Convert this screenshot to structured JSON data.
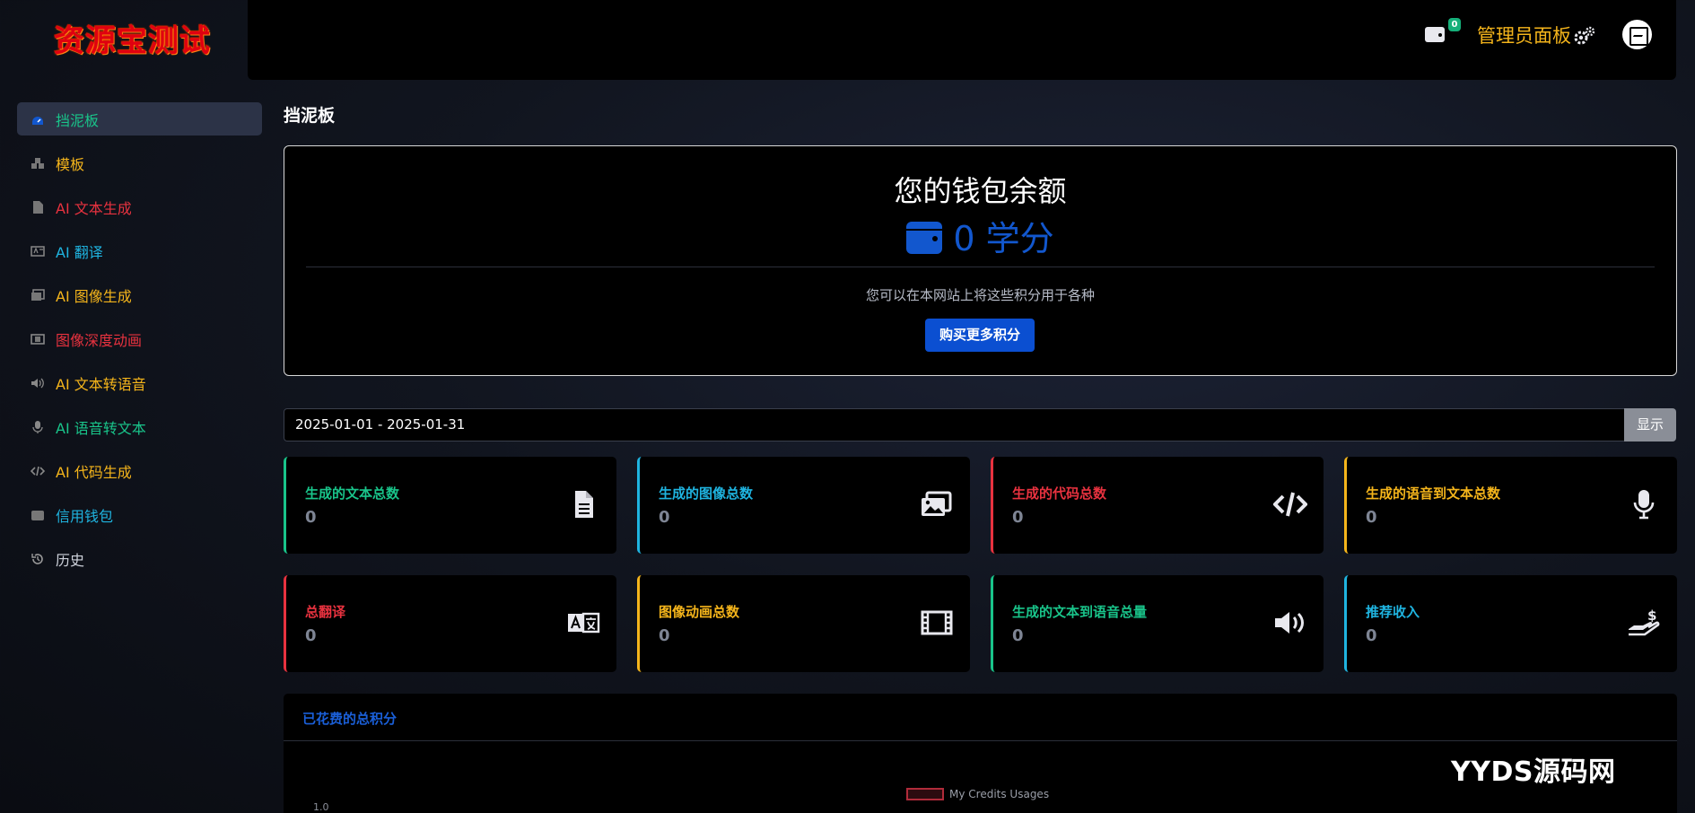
{
  "header": {
    "logo_text": "资源宝测试",
    "wallet_badge": "0",
    "admin_label": "管理员面板"
  },
  "sidebar": {
    "items": [
      {
        "label": "挡泥板",
        "color": "#19c48a",
        "icon": "dashboard-icon",
        "active": true
      },
      {
        "label": "模板",
        "color": "#f5b51b",
        "icon": "boxes-icon"
      },
      {
        "label": "AI 文本生成",
        "color": "#e8323f",
        "icon": "file-icon"
      },
      {
        "label": "AI 翻译",
        "color": "#1fb4e0",
        "icon": "language-icon"
      },
      {
        "label": "AI 图像生成",
        "color": "#f5b51b",
        "icon": "images-icon"
      },
      {
        "label": "图像深度动画",
        "color": "#e8323f",
        "icon": "film-icon"
      },
      {
        "label": "AI 文本转语音",
        "color": "#f5b51b",
        "icon": "volume-icon"
      },
      {
        "label": "AI 语音转文本",
        "color": "#19c48a",
        "icon": "microphone-icon"
      },
      {
        "label": "AI 代码生成",
        "color": "#f5b51b",
        "icon": "code-icon"
      },
      {
        "label": "信用钱包",
        "color": "#1fb4e0",
        "icon": "wallet-icon"
      },
      {
        "label": "历史",
        "color": "#cfd3dc",
        "icon": "history-icon"
      }
    ]
  },
  "page": {
    "title": "挡泥板"
  },
  "wallet": {
    "title": "您的钱包余额",
    "amount": "0 学分",
    "description": "您可以在本网站上将这些积分用于各种",
    "buy_label": "购买更多积分"
  },
  "filter": {
    "date_range": "2025-01-01 - 2025-01-31",
    "show_label": "显示"
  },
  "stats": [
    {
      "label": "生成的文本总数",
      "value": "0",
      "color": "#19c48a",
      "icon": "file-lines-icon"
    },
    {
      "label": "生成的图像总数",
      "value": "0",
      "color": "#1fb4e0",
      "icon": "images-icon"
    },
    {
      "label": "生成的代码总数",
      "value": "0",
      "color": "#e8323f",
      "icon": "code-icon"
    },
    {
      "label": "生成的语音到文本总数",
      "value": "0",
      "color": "#f5b51b",
      "icon": "microphone-icon"
    },
    {
      "label": "总翻译",
      "value": "0",
      "color": "#e8323f",
      "icon": "language-icon"
    },
    {
      "label": "图像动画总数",
      "value": "0",
      "color": "#f5b51b",
      "icon": "film-icon"
    },
    {
      "label": "生成的文本到语音总量",
      "value": "0",
      "color": "#19c48a",
      "icon": "volume-icon"
    },
    {
      "label": "推荐收入",
      "value": "0",
      "color": "#1fb4e0",
      "icon": "hand-dollar-icon"
    }
  ],
  "credits": {
    "title": "已花费的总积分",
    "legend": "My Credits Usages",
    "y_tick": "1.0"
  },
  "watermark": "YYDS源码网"
}
